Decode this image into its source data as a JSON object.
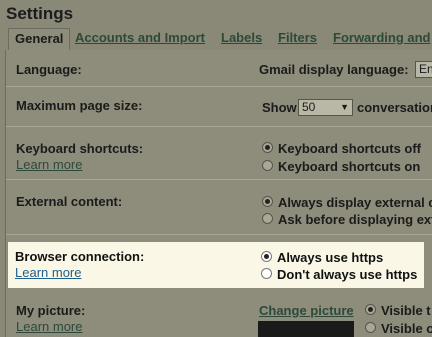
{
  "title": "Settings",
  "tabs": [
    {
      "label": "General",
      "active": true
    },
    {
      "label": "Accounts and Import"
    },
    {
      "label": "Labels"
    },
    {
      "label": "Filters"
    },
    {
      "label": "Forwarding and"
    }
  ],
  "language": {
    "label": "Language:",
    "display_label": "Gmail display language:",
    "display_value": "En"
  },
  "page_size": {
    "label": "Maximum page size:",
    "show": "Show",
    "value": "50",
    "suffix": "conversation"
  },
  "keyboard": {
    "label": "Keyboard shortcuts:",
    "learn_more": "Learn more",
    "options": [
      "Keyboard shortcuts off",
      "Keyboard shortcuts on"
    ],
    "selected": 0
  },
  "external": {
    "label": "External content:",
    "options": [
      "Always display external c",
      "Ask before displaying ext"
    ],
    "selected": 0
  },
  "browser": {
    "label": "Browser connection:",
    "learn_more": "Learn more",
    "options": [
      "Always use https",
      "Don't always use https"
    ],
    "selected": 0
  },
  "picture": {
    "label": "My picture:",
    "learn_more": "Learn more",
    "change": "Change picture",
    "options": [
      "Visible t",
      "Visible o"
    ],
    "selected": 0
  }
}
